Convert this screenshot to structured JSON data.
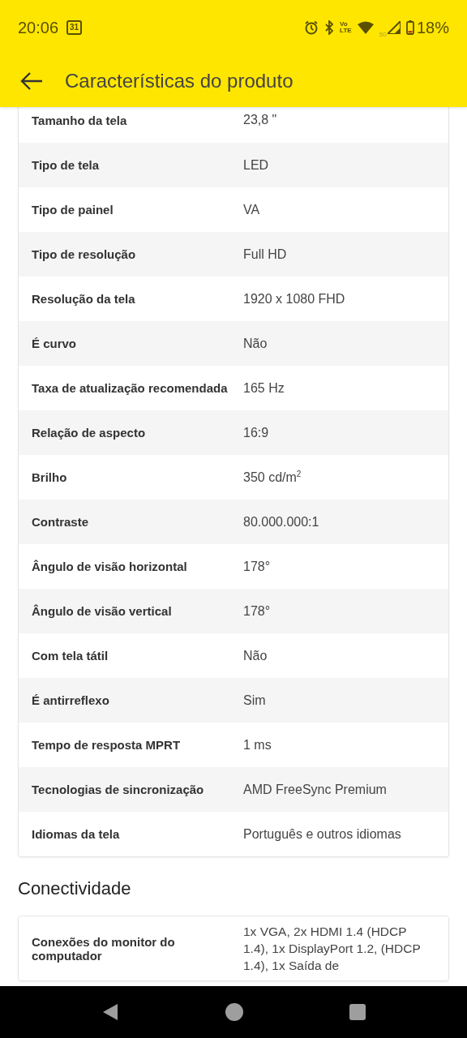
{
  "status_bar": {
    "time": "20:06",
    "calendar_day": "31",
    "volte_top": "Vo",
    "volte_bottom": "LTE",
    "network_small": "5G",
    "battery": "18%"
  },
  "app_bar": {
    "title": "Características do produto"
  },
  "specs": [
    {
      "label": "Tamanho da tela",
      "value": "23,8 \""
    },
    {
      "label": "Tipo de tela",
      "value": "LED"
    },
    {
      "label": "Tipo de painel",
      "value": "VA"
    },
    {
      "label": "Tipo de resolução",
      "value": "Full HD"
    },
    {
      "label": "Resolução da tela",
      "value": "1920 x 1080 FHD"
    },
    {
      "label": "É curvo",
      "value": "Não"
    },
    {
      "label": "Taxa de atualização recomendada",
      "value": "165 Hz"
    },
    {
      "label": "Relação de aspecto",
      "value": "16:9"
    },
    {
      "label": "Brilho",
      "value": "350 cd/m$^{2}$"
    },
    {
      "label": "Contraste",
      "value": "80.000.000:1"
    },
    {
      "label": "Ângulo de visão horizontal",
      "value": "178°"
    },
    {
      "label": "Ângulo de visão vertical",
      "value": "178°"
    },
    {
      "label": "Com tela tátil",
      "value": "Não"
    },
    {
      "label": "É antirreflexo",
      "value": "Sim"
    },
    {
      "label": "Tempo de resposta MPRT",
      "value": "1 ms"
    },
    {
      "label": "Tecnologias de sincronização",
      "value": "AMD FreeSync Premium"
    },
    {
      "label": "Idiomas da tela",
      "value": "Português e outros idiomas"
    }
  ],
  "section": {
    "title": "Conectividade",
    "rows": [
      {
        "label": "Conexões do monitor do computador",
        "value": "1x VGA, 2x HDMI 1.4 (HDCP 1.4), 1x DisplayPort 1.2, (HDCP 1.4), 1x Saída de"
      }
    ]
  }
}
